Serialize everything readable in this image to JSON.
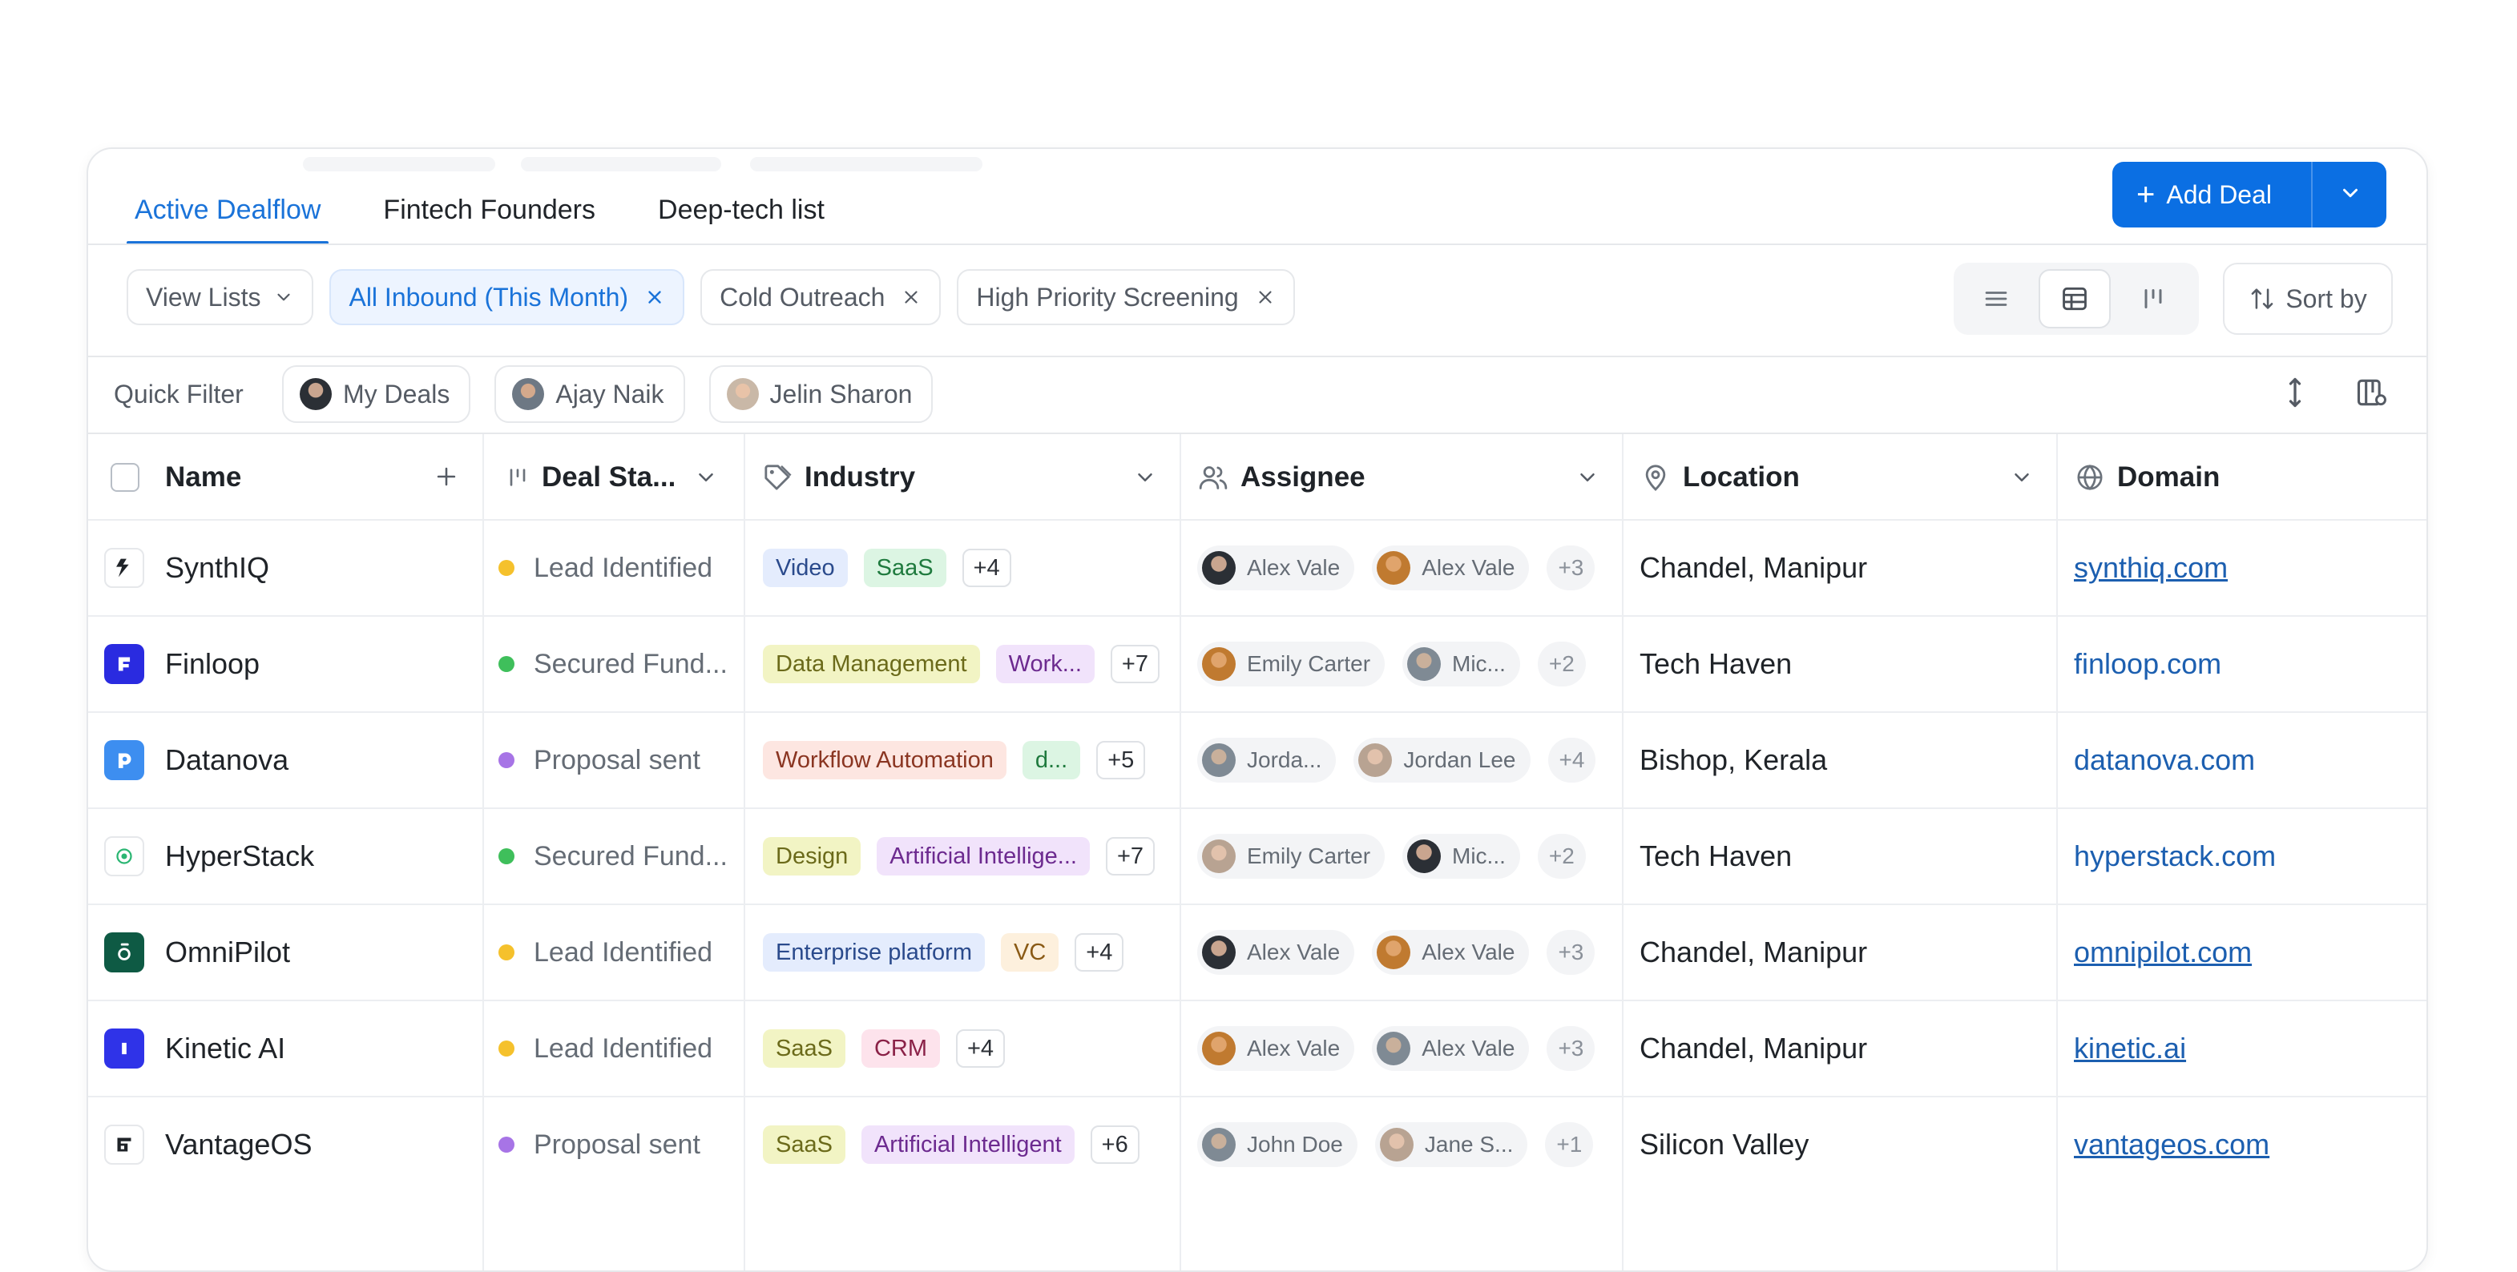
{
  "tabs": [
    {
      "label": "Active Dealflow",
      "active": true
    },
    {
      "label": "Fintech Founders",
      "active": false
    },
    {
      "label": "Deep-tech list",
      "active": false
    }
  ],
  "add_deal_label": "Add Deal",
  "filters": {
    "view_lists": "View Lists",
    "chips": [
      {
        "label": "All Inbound (This Month)",
        "active": true
      },
      {
        "label": "Cold Outreach",
        "active": false
      },
      {
        "label": "High Priority Screening",
        "active": false
      }
    ],
    "sort_label": "Sort by"
  },
  "quick_filter": {
    "label": "Quick Filter",
    "chips": [
      "My Deals",
      "Ajay Naik",
      "Jelin Sharon"
    ]
  },
  "columns": {
    "name": "Name",
    "stage": "Deal Sta...",
    "industry": "Industry",
    "assignee": "Assignee",
    "location": "Location",
    "domain": "Domain"
  },
  "colors": {
    "accent": "#0b6fe3",
    "stage_yellow": "#f5c12c",
    "stage_green": "#3fbf5b",
    "stage_purple": "#a774e6"
  },
  "rows": [
    {
      "name": "SynthIQ",
      "stage": "Lead Identified",
      "stage_color": "#f5c12c",
      "tags": [
        {
          "t": "Video",
          "c": "blue"
        },
        {
          "t": "SaaS",
          "c": "green"
        }
      ],
      "tag_more": "+4",
      "people": [
        "Alex Vale",
        "Alex Vale"
      ],
      "people_more": "+3",
      "location": "Chandel, Manipur",
      "domain": "synthiq.com",
      "underline": true
    },
    {
      "name": "Finloop",
      "stage": "Secured Fund...",
      "stage_color": "#3fbf5b",
      "tags": [
        {
          "t": "Data Management",
          "c": "yellow"
        },
        {
          "t": "Work...",
          "c": "purple"
        }
      ],
      "tag_more": "+7",
      "people": [
        "Emily Carter",
        "Mic..."
      ],
      "people_more": "+2",
      "location": "Tech Haven",
      "domain": "finloop.com",
      "underline": false
    },
    {
      "name": "Datanova",
      "stage": "Proposal sent",
      "stage_color": "#a774e6",
      "tags": [
        {
          "t": "Workflow Automation",
          "c": "red"
        },
        {
          "t": "d...",
          "c": "green"
        }
      ],
      "tag_more": "+5",
      "people": [
        "Jorda...",
        "Jordan Lee"
      ],
      "people_more": "+4",
      "location": "Bishop, Kerala",
      "domain": "datanova.com",
      "underline": false
    },
    {
      "name": "HyperStack",
      "stage": "Secured Fund...",
      "stage_color": "#3fbf5b",
      "tags": [
        {
          "t": "Design",
          "c": "yellow"
        },
        {
          "t": "Artificial Intellige...",
          "c": "purple"
        }
      ],
      "tag_more": "+7",
      "people": [
        "Emily Carter",
        "Mic..."
      ],
      "people_more": "+2",
      "location": "Tech Haven",
      "domain": "hyperstack.com",
      "underline": false
    },
    {
      "name": "OmniPilot",
      "stage": "Lead Identified",
      "stage_color": "#f5c12c",
      "tags": [
        {
          "t": "Enterprise platform",
          "c": "blue"
        },
        {
          "t": "VC",
          "c": "orange"
        }
      ],
      "tag_more": "+4",
      "people": [
        "Alex Vale",
        "Alex Vale"
      ],
      "people_more": "+3",
      "location": "Chandel, Manipur",
      "domain": "omnipilot.com",
      "underline": true
    },
    {
      "name": "Kinetic AI",
      "stage": "Lead Identified",
      "stage_color": "#f5c12c",
      "tags": [
        {
          "t": "SaaS",
          "c": "yellow"
        },
        {
          "t": "CRM",
          "c": "pink"
        }
      ],
      "tag_more": "+4",
      "people": [
        "Alex Vale",
        "Alex Vale"
      ],
      "people_more": "+3",
      "location": "Chandel, Manipur",
      "domain": "kinetic.ai",
      "underline": true
    },
    {
      "name": "VantageOS",
      "stage": "Proposal sent",
      "stage_color": "#a774e6",
      "tags": [
        {
          "t": "SaaS",
          "c": "yellow"
        },
        {
          "t": "Artificial Intelligent",
          "c": "purple"
        }
      ],
      "tag_more": "+6",
      "people": [
        "John Doe",
        "Jane S..."
      ],
      "people_more": "+1",
      "location": "Silicon Valley",
      "domain": "vantageos.com",
      "underline": true
    }
  ]
}
